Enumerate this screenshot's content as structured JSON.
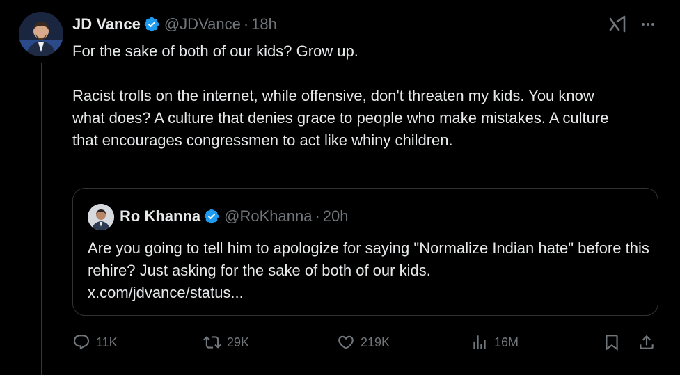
{
  "tweet": {
    "author": {
      "display_name": "JD Vance",
      "handle": "@JDVance",
      "verified": true
    },
    "separator": "·",
    "time": "18h",
    "text_lines": [
      "For the sake of both of our kids? Grow up.",
      "Racist trolls on the internet, while offensive, don't threaten my kids. You know what does? A culture that denies grace to people who make mistakes. A culture that encourages congressmen to act like whiny children."
    ],
    "quote": {
      "author": {
        "display_name": "Ro Khanna",
        "handle": "@RoKhanna",
        "verified": true
      },
      "separator": "·",
      "time": "20h",
      "text": "Are you going to tell him to apologize for saying \"Normalize Indian hate\" before this rehire? Just asking for the sake of both of our kids.",
      "link": "x.com/jdvance/status..."
    },
    "actions": {
      "replies": "11K",
      "reposts": "29K",
      "likes": "219K",
      "views": "16M"
    }
  },
  "icons": {
    "reply": "reply-icon",
    "repost": "repost-icon",
    "like": "heart-icon",
    "views": "views-icon",
    "bookmark": "bookmark-icon",
    "share": "share-icon",
    "verified": "verified-badge-icon",
    "grok": "grok-icon",
    "more": "more-icon"
  },
  "colors": {
    "background": "#000000",
    "text": "#e7e9ea",
    "secondary": "#71767b",
    "verified_blue": "#1d9bf0",
    "border": "#2f3336"
  }
}
